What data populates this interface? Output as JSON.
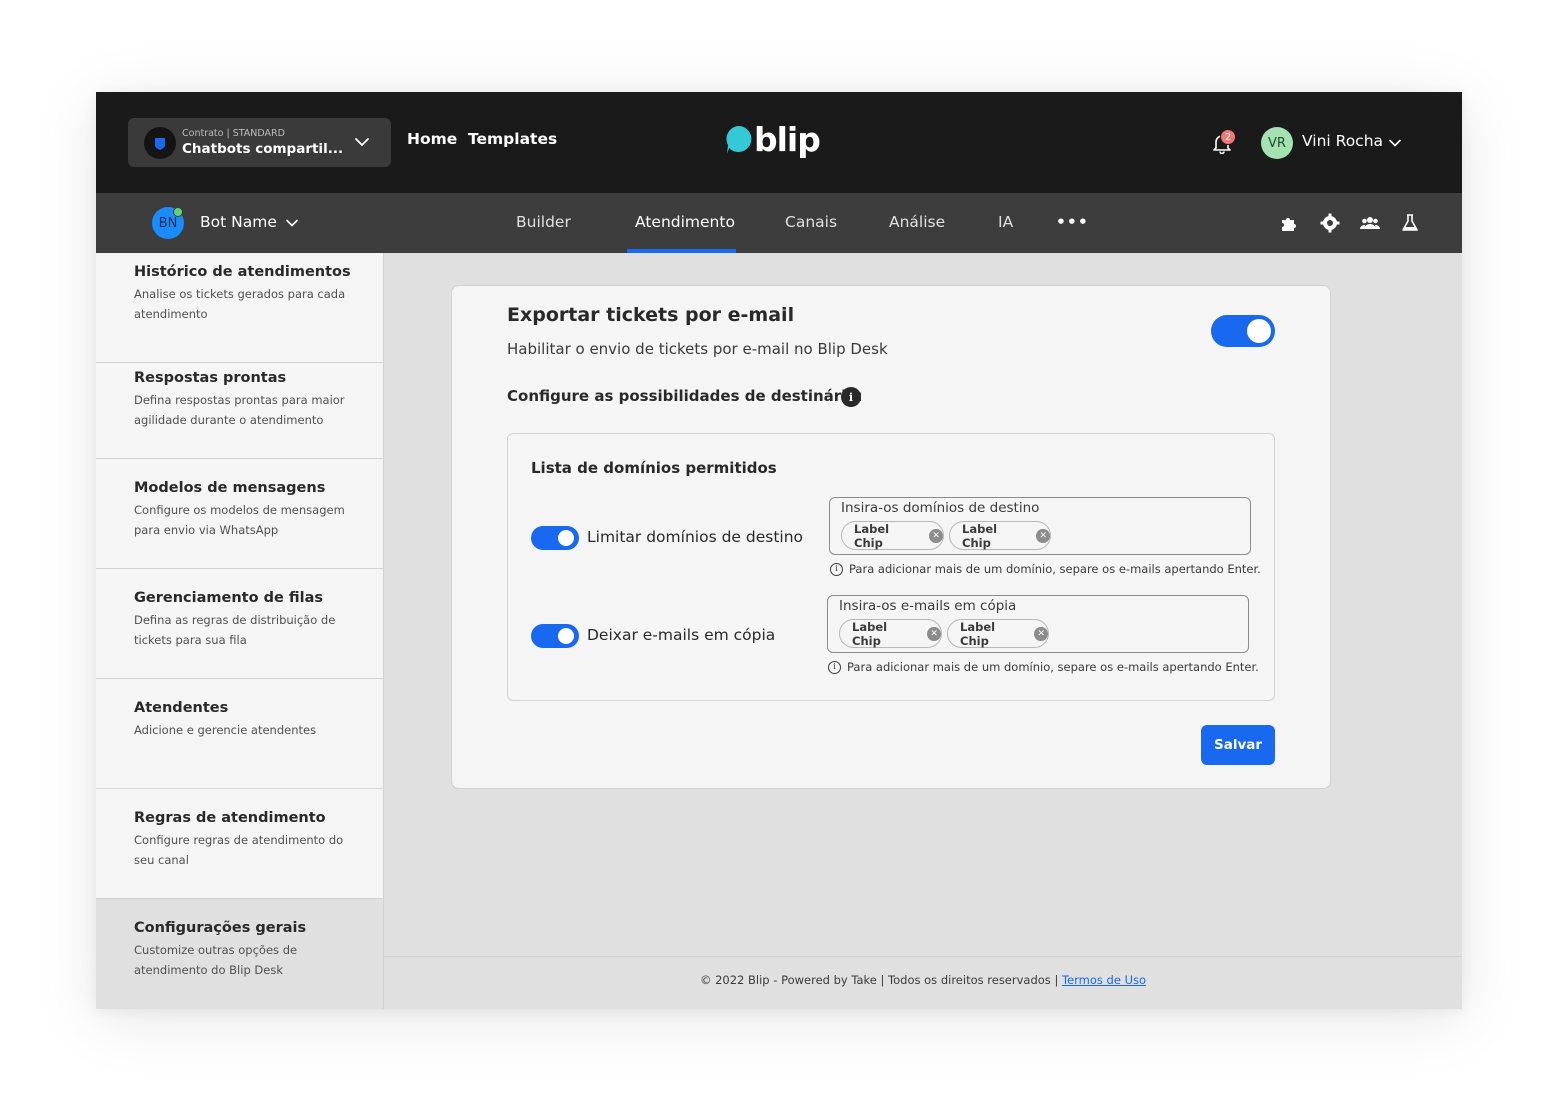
{
  "topbar": {
    "contract_small": "Contrato | STANDARD",
    "contract_name": "Chatbots compartil...",
    "nav": [
      "Home",
      "Templates"
    ],
    "logo_text": "blip",
    "notification_count": "2",
    "user_initials": "VR",
    "user_name": "Vini Rocha"
  },
  "subbar": {
    "bot_initials": "BN",
    "bot_name": "Bot Name",
    "tabs": [
      "Builder",
      "Atendimento",
      "Canais",
      "Análise",
      "IA"
    ],
    "active_tab": "Atendimento",
    "more": "•••",
    "icons": [
      "puzzle-icon",
      "gear-icon",
      "team-icon",
      "flask-icon"
    ]
  },
  "sidebar": {
    "items": [
      {
        "title": "Histórico de atendimentos",
        "desc": "Analise os tickets gerados para cada atendimento"
      },
      {
        "title": "Respostas prontas",
        "desc": "Defina respostas prontas para maior agilidade durante o atendimento"
      },
      {
        "title": "Modelos de mensagens",
        "desc": "Configure os modelos de mensagem para envio via WhatsApp"
      },
      {
        "title": "Gerenciamento de filas",
        "desc": "Defina as regras de distribuição de tickets para sua fila"
      },
      {
        "title": "Atendentes",
        "desc": "Adicione e gerencie atendentes"
      },
      {
        "title": "Regras de atendimento",
        "desc": "Configure regras de atendimento do seu canal"
      },
      {
        "title": "Configurações gerais",
        "desc": "Customize outras opções de atendimento do Blip Desk"
      }
    ],
    "active_index": 6
  },
  "card": {
    "title": "Exportar tickets por e-mail",
    "subtitle": "Habilitar o envio de tickets por e-mail no Blip Desk",
    "enabled": true,
    "config_label": "Configure as possibilidades de destinário:",
    "info_glyph": "i",
    "inner": {
      "title": "Lista de domínios permitidos",
      "rows": [
        {
          "label": "Limitar domínios de destino",
          "enabled": true,
          "field_label": "Insira-os domínios de destino",
          "chips": [
            "Label Chip",
            "Label Chip"
          ],
          "helper": "Para adicionar mais de um domínio, separe os e-mails apertando Enter."
        },
        {
          "label": "Deixar e-mails em cópia",
          "enabled": true,
          "field_label": "Insira-os e-mails em cópia",
          "chips": [
            "Label Chip",
            "Label Chip"
          ],
          "helper": "Para adicionar mais de um domínio, separe os e-mails apertando Enter."
        }
      ]
    },
    "save_label": "Salvar"
  },
  "footer": {
    "text": "© 2022 Blip - Powered by Take | Todos os direitos reservados | ",
    "link": "Termos de Uso"
  },
  "colors": {
    "accent": "#1968f0",
    "topbar": "#1a1a1a",
    "subbar": "#3d3d3d",
    "logo": "#33c9d6"
  }
}
